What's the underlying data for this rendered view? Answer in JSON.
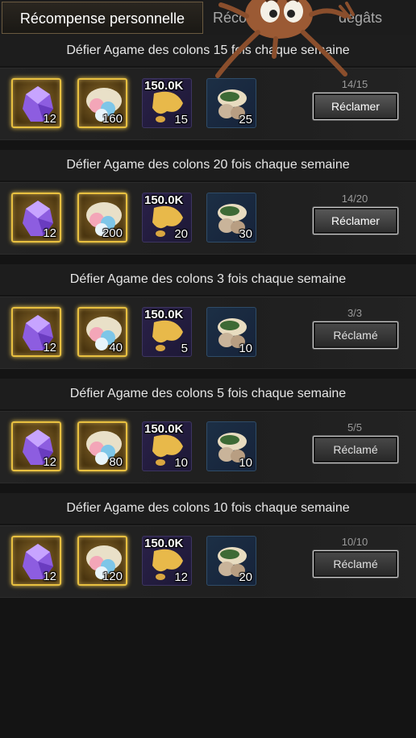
{
  "tabs": [
    {
      "label": "Récompense personnelle"
    },
    {
      "label": "Récom"
    },
    {
      "label": "dégâts"
    }
  ],
  "sections": [
    {
      "title": "Défier Agame des colons 15 fois chaque semaine",
      "items": [
        {
          "qty": "12"
        },
        {
          "qty": "160"
        },
        {
          "top": "150.0K",
          "qty": "15"
        },
        {
          "qty": "25"
        }
      ],
      "progress": "14/15",
      "button": "Réclamer"
    },
    {
      "title": "Défier Agame des colons 20 fois chaque semaine",
      "items": [
        {
          "qty": "12"
        },
        {
          "qty": "200"
        },
        {
          "top": "150.0K",
          "qty": "20"
        },
        {
          "qty": "30"
        }
      ],
      "progress": "14/20",
      "button": "Réclamer"
    },
    {
      "title": "Défier Agame des colons 3 fois chaque semaine",
      "items": [
        {
          "qty": "12"
        },
        {
          "qty": "40"
        },
        {
          "top": "150.0K",
          "qty": "5"
        },
        {
          "qty": "10"
        }
      ],
      "progress": "3/3",
      "button": "Réclamé"
    },
    {
      "title": "Défier Agame des colons 5 fois chaque semaine",
      "items": [
        {
          "qty": "12"
        },
        {
          "qty": "80"
        },
        {
          "top": "150.0K",
          "qty": "10"
        },
        {
          "qty": "10"
        }
      ],
      "progress": "5/5",
      "button": "Réclamé"
    },
    {
      "title": "Défier Agame des colons 10 fois chaque semaine",
      "items": [
        {
          "qty": "12"
        },
        {
          "qty": "120"
        },
        {
          "top": "150.0K",
          "qty": "12"
        },
        {
          "qty": "20"
        }
      ],
      "progress": "10/10",
      "button": "Réclamé"
    }
  ],
  "colors": {
    "gold_frame": "#e8c040",
    "background": "#141414",
    "button": "#3a3a3a"
  },
  "icons": [
    "purple-crystal-icon",
    "dough-balls-icon",
    "gold-coins-icon",
    "mushroom-food-icon",
    "ant-mascot-icon"
  ]
}
